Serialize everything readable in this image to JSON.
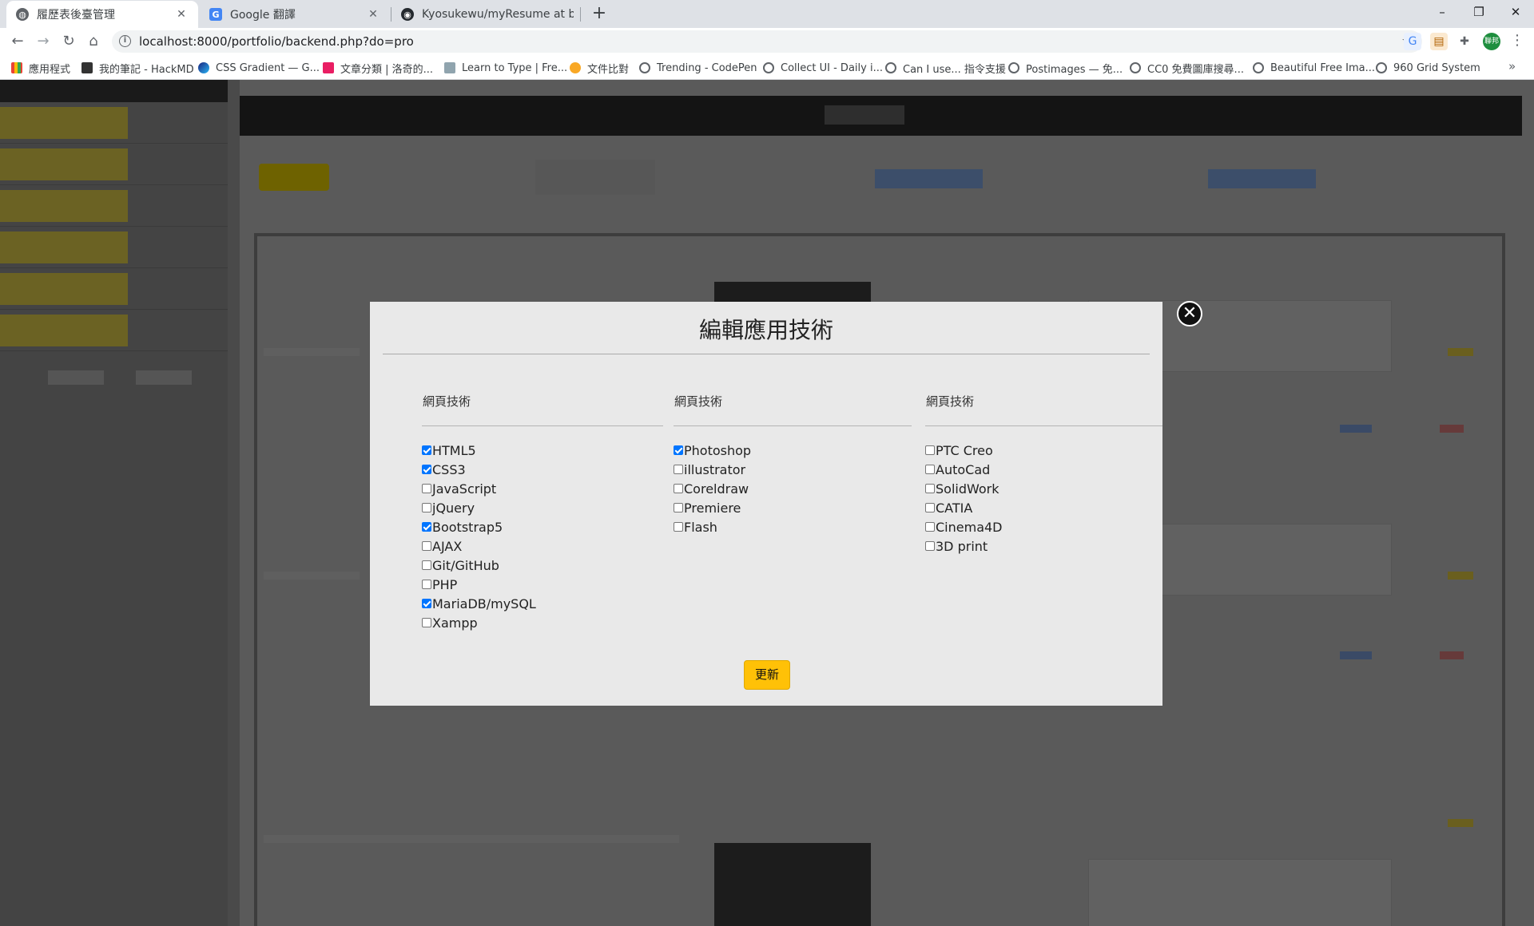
{
  "browser": {
    "tabs": [
      {
        "title": "履歷表後臺管理",
        "active": true
      },
      {
        "title": "Google 翻譯",
        "active": false
      },
      {
        "title": "Kyosukewu/myResume at back",
        "active": false
      }
    ],
    "new_tab_label": "+",
    "window_controls": {
      "minimize": "–",
      "restore": "❐",
      "close": "✕"
    },
    "url": "localhost:8000/portfolio/backend.php?do=pro",
    "profile_label": "聯邦",
    "bookmarks": [
      "應用程式",
      "我的筆記 - HackMD",
      "CSS Gradient — G...",
      "文章分類 | 洛奇的...",
      "Learn to Type | Fre...",
      "文件比對",
      "Trending - CodePen",
      "Collect UI - Daily i...",
      "Can I use... 指令支援",
      "Postimages — 免...",
      "CC0 免費圖庫搜尋...",
      "Beautiful Free Ima...",
      "960 Grid System"
    ],
    "bookmarks_more": "»"
  },
  "modal": {
    "title": "編輯應用技術",
    "close_label": "✕",
    "update_label": "更新",
    "columns": [
      {
        "title": "網頁技術",
        "options": [
          {
            "label": "HTML5",
            "checked": true
          },
          {
            "label": "CSS3",
            "checked": true
          },
          {
            "label": "JavaScript",
            "checked": false
          },
          {
            "label": "jQuery",
            "checked": false
          },
          {
            "label": "Bootstrap5",
            "checked": true
          },
          {
            "label": "AJAX",
            "checked": false
          },
          {
            "label": "Git/GitHub",
            "checked": false
          },
          {
            "label": "PHP",
            "checked": false
          },
          {
            "label": "MariaDB/mySQL",
            "checked": true
          },
          {
            "label": "Xampp",
            "checked": false
          }
        ]
      },
      {
        "title": "網頁技術",
        "options": [
          {
            "label": "Photoshop",
            "checked": true
          },
          {
            "label": "illustrator",
            "checked": false
          },
          {
            "label": "Coreldraw",
            "checked": false
          },
          {
            "label": "Premiere",
            "checked": false
          },
          {
            "label": "Flash",
            "checked": false
          }
        ]
      },
      {
        "title": "網頁技術",
        "options": [
          {
            "label": "PTC Creo",
            "checked": false
          },
          {
            "label": "AutoCad",
            "checked": false
          },
          {
            "label": "SolidWork",
            "checked": false
          },
          {
            "label": "CATIA",
            "checked": false
          },
          {
            "label": "Cinema4D",
            "checked": false
          },
          {
            "label": "3D print",
            "checked": false
          }
        ]
      }
    ]
  },
  "colors": {
    "accent_yellow": "#ffc107",
    "checkbox_blue": "#0075ff",
    "overlay": "#4a4a4a"
  }
}
